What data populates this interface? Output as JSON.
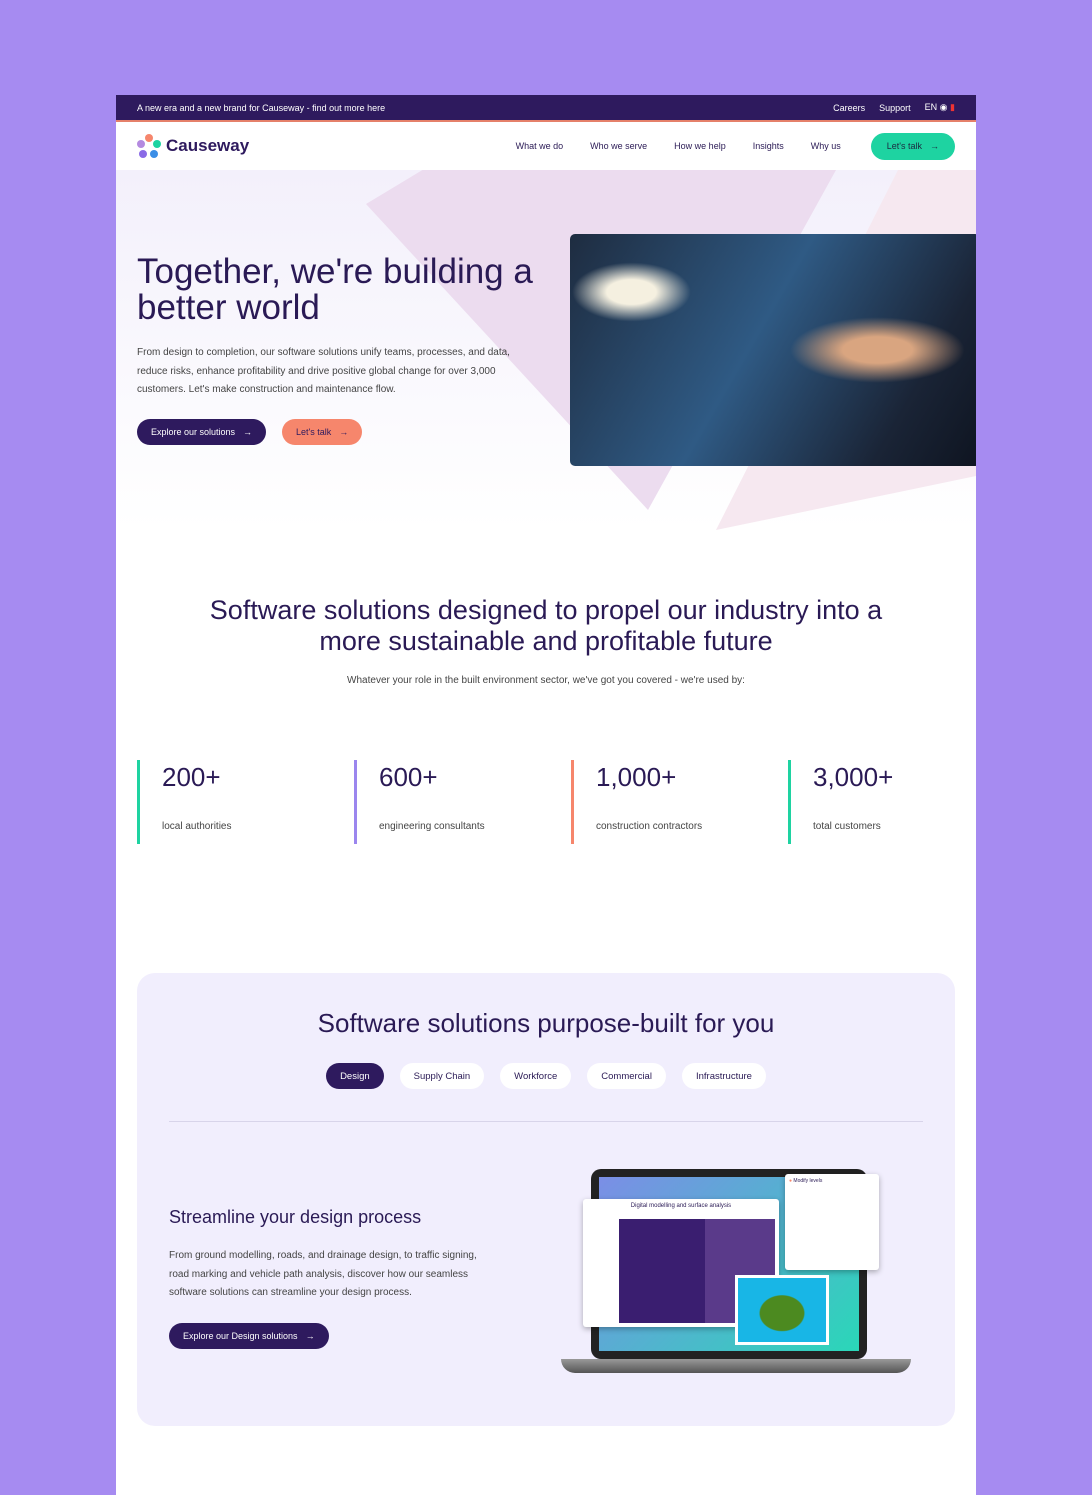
{
  "topbar": {
    "announcement": "A new era and a new brand for Causeway - find out more here",
    "careers": "Careers",
    "support": "Support",
    "lang": "EN"
  },
  "nav": {
    "brand": "Causeway",
    "items": [
      "What we do",
      "Who we serve",
      "How we help",
      "Insights",
      "Why us"
    ],
    "cta": "Let's talk"
  },
  "hero": {
    "title": "Together, we're building a better world",
    "body": "From design to completion, our software solutions unify teams, processes, and data, reduce risks, enhance profitability and drive positive global change for over 3,000 customers. Let's make construction and maintenance flow.",
    "primary": "Explore our solutions",
    "secondary": "Let's talk"
  },
  "intro": {
    "title": "Software solutions designed to propel our industry into a more sustainable and profitable future",
    "subtitle": "Whatever your role in the built environment sector, we've got you covered - we're used by:"
  },
  "stats": [
    {
      "value": "200+",
      "label": "local authorities",
      "color": "#1ed3a1"
    },
    {
      "value": "600+",
      "label": "engineering consultants",
      "color": "#9b86ee"
    },
    {
      "value": "1,000+",
      "label": "construction contractors",
      "color": "#f6866c"
    },
    {
      "value": "3,000+",
      "label": "total customers",
      "color": "#1ed3a1"
    }
  ],
  "solutions": {
    "title": "Software solutions purpose-built for you",
    "tabs": [
      "Design",
      "Supply Chain",
      "Workforce",
      "Commercial",
      "Infrastructure"
    ],
    "active_tab": "Design",
    "heading": "Streamline your design process",
    "body": "From ground modelling, roads, and drainage design, to traffic signing, road marking and vehicle path analysis, discover how our seamless software solutions can streamline your design process.",
    "cta": "Explore our Design solutions",
    "screen_title": "Digital modelling and surface analysis",
    "dialog_title": "Modify levels"
  },
  "colors": {
    "brand": "#2e1a5e",
    "accent_green": "#1ed3a1",
    "accent_coral": "#f6866c",
    "background": "#a68bf1"
  }
}
